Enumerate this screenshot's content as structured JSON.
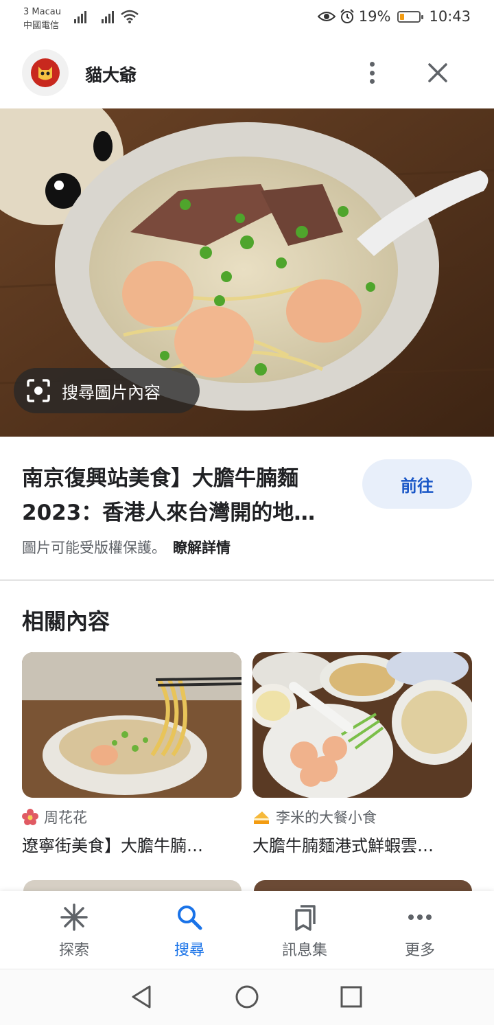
{
  "status_bar": {
    "carrier_line1": "3 Macau",
    "carrier_line2": "中國電信",
    "battery_percent": "19%",
    "battery_level": 0.19,
    "time": "10:43",
    "icons": [
      "signal-icon",
      "signal-icon",
      "wifi-icon",
      "eye-icon",
      "alarm-icon",
      "battery-icon"
    ]
  },
  "header": {
    "site_name": "貓大爺",
    "logo_icon": "cat-logo",
    "menu_icon": "more-vert-icon",
    "close_icon": "close-icon"
  },
  "hero": {
    "lens_label": "搜尋圖片內容",
    "lens_icon": "lens-icon"
  },
  "result": {
    "title_line1": "南京復興站美食】大膽牛腩麵",
    "title_line2": "2023：香港人來台灣開的地…",
    "go_label": "前往",
    "copyright_text": "圖片可能受版權保護。",
    "learn_more": "瞭解詳情"
  },
  "related": {
    "heading": "相關內容",
    "cards": [
      {
        "source": "周花花",
        "source_icon": "flower-icon",
        "title": "遼寧街美食】大膽牛腩…"
      },
      {
        "source": "李米的大餐小食",
        "source_icon": "cake-icon",
        "title": "大膽牛腩麵港式鮮蝦雲…"
      }
    ]
  },
  "bottom_nav": {
    "items": [
      {
        "label": "探索",
        "icon": "asterisk-icon"
      },
      {
        "label": "搜尋",
        "icon": "search-icon",
        "active": true
      },
      {
        "label": "訊息集",
        "icon": "collections-icon"
      },
      {
        "label": "更多",
        "icon": "more-horiz-icon"
      }
    ]
  },
  "colors": {
    "accent": "#1a73e8",
    "go_button_bg": "#e8effa",
    "go_button_text": "#1a57c7",
    "battery": "#f39c12"
  }
}
